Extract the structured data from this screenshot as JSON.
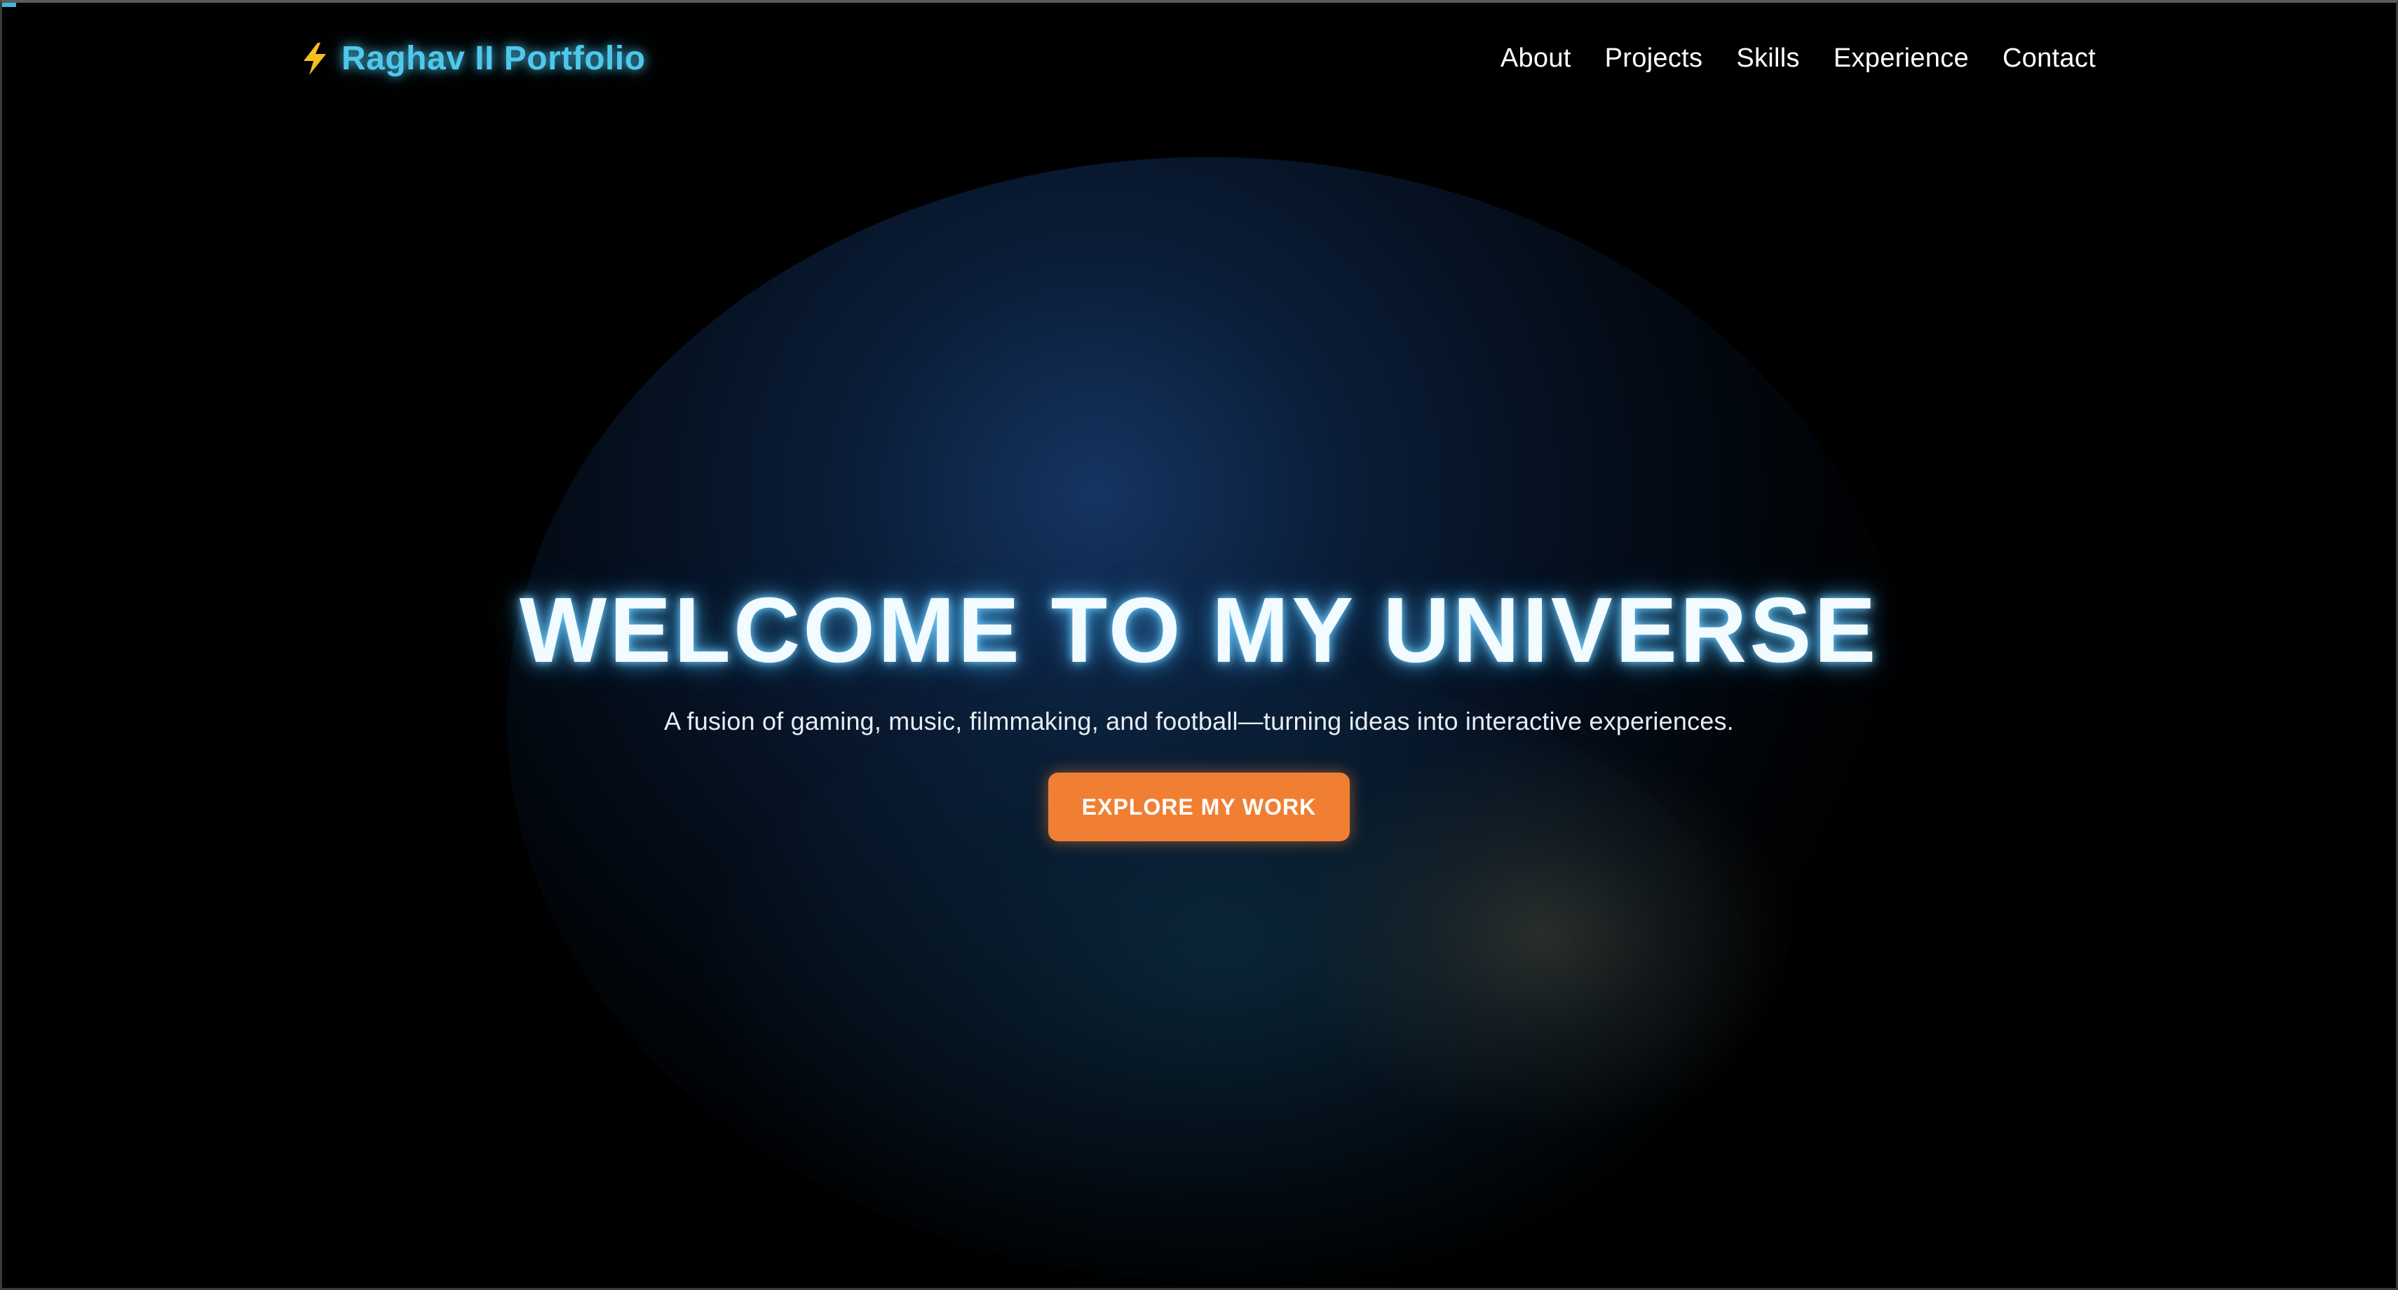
{
  "brand": {
    "icon": "lightning-bolt-icon",
    "label": "Raghav II Portfolio"
  },
  "nav": {
    "items": [
      {
        "label": "About"
      },
      {
        "label": "Projects"
      },
      {
        "label": "Skills"
      },
      {
        "label": "Experience"
      },
      {
        "label": "Contact"
      }
    ]
  },
  "hero": {
    "title": "WELCOME TO MY UNIVERSE",
    "subtitle": "A fusion of gaming, music, filmmaking, and football—turning ideas into interactive experiences.",
    "cta_label": "EXPLORE MY WORK"
  },
  "colors": {
    "background": "#000000",
    "brand_accent": "#4fc8ec",
    "cta": "#f07f33",
    "glow_blue": "#1c4682"
  }
}
